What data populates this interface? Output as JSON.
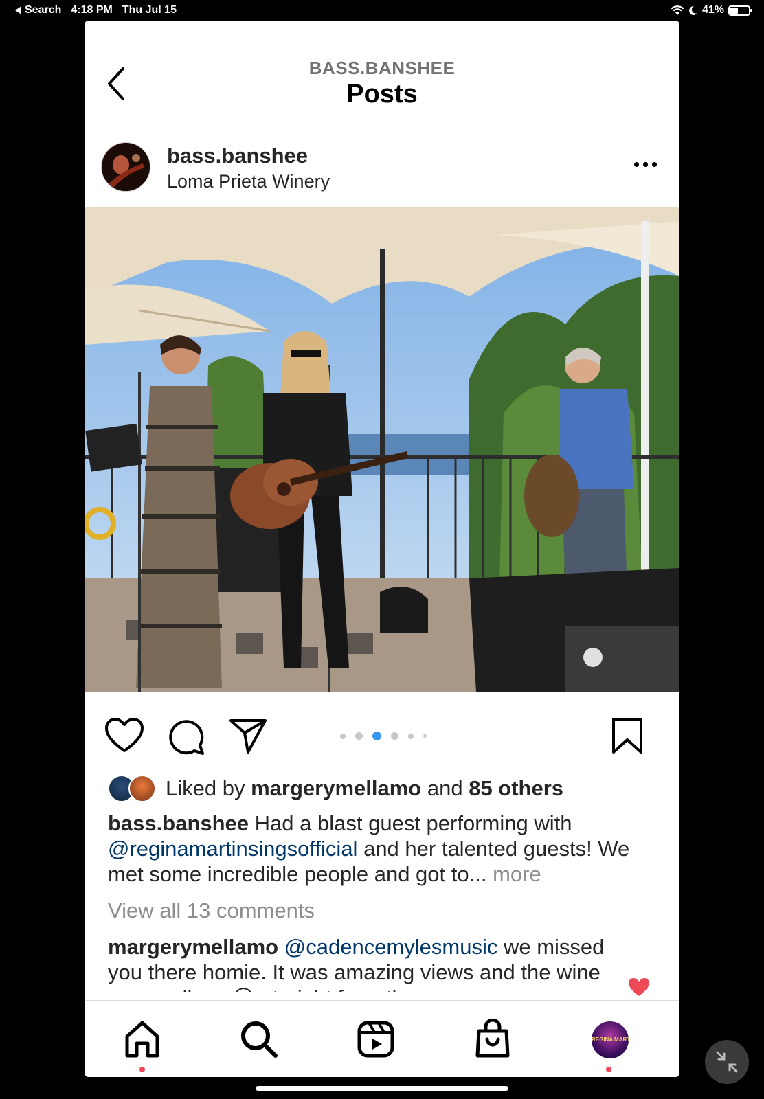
{
  "status_bar": {
    "back_app": "Search",
    "time": "4:18 PM",
    "date": "Thu Jul 15",
    "battery_percent_label": "41%",
    "battery_level": 0.41
  },
  "header": {
    "username": "BASS.BANSHEE",
    "title": "Posts"
  },
  "post": {
    "username": "bass.banshee",
    "location": "Loma Prieta Winery",
    "carousel": {
      "count": 6,
      "active_index": 2
    },
    "likes": {
      "prefix": "Liked by",
      "liker": "margerymellamo",
      "joiner": "and",
      "others": "85 others"
    },
    "caption": {
      "username": "bass.banshee",
      "text_1": "Had a blast guest performing with",
      "mention": "@reginamartinsingsofficial",
      "text_2": "and her talented guests! We met some incredible people and got to...",
      "more": "more"
    },
    "view_comments": "View all 13 comments",
    "comment": {
      "username": "margerymellamo",
      "mention": "@cadencemylesmusic",
      "text": "we missed you there homie. It was amazing views and the wine was endless 😂 straight from the"
    }
  },
  "tabbar": {
    "profile_label": "REGINA MARTIN"
  },
  "colors": {
    "accent_blue": "#3897f0",
    "mention": "#00376b",
    "heart_red": "#ed4956",
    "muted": "#8e8e8e"
  }
}
